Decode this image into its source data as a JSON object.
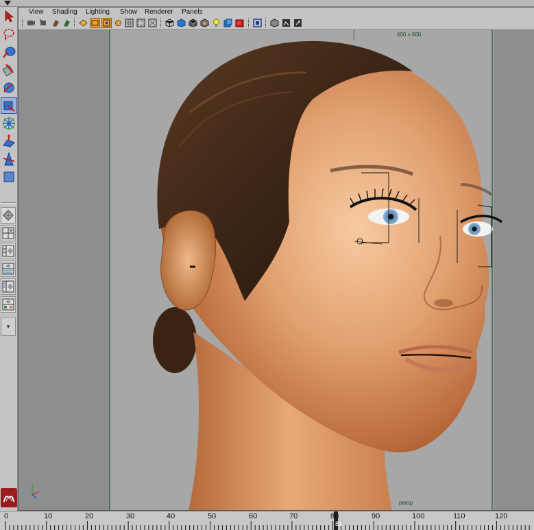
{
  "menubar": {
    "items": [
      "View",
      "Shading",
      "Lighting",
      "Show",
      "Renderer",
      "Panels"
    ]
  },
  "viewport": {
    "resolution_label": "600 x 600",
    "camera_label": "persp"
  },
  "timeline": {
    "ticks": [
      "0",
      "10",
      "20",
      "30",
      "40",
      "50",
      "60",
      "70",
      "80",
      "90",
      "100",
      "110",
      "120"
    ],
    "current_frame": "81"
  },
  "toolbox": {
    "layout_dropdown_symbol": "▾"
  },
  "colors": {
    "ui_gray": "#c4c4c4",
    "viewport_bg": "#8e8e8e",
    "resolution_gate": "#a7a7a7",
    "skin": "#d9976a",
    "hair": "#3a2415",
    "active_tool": "#9fb3d6",
    "active_toggle": "#f0a030",
    "gate_line": "#1f5a36"
  },
  "icons": {
    "tools": [
      "select-arrow-icon",
      "lasso-icon",
      "paint-select-icon",
      "move-icon",
      "rotate-icon",
      "scale-icon",
      "universal-manip-icon",
      "soft-mod-icon",
      "show-manipulator-icon"
    ],
    "layouts": [
      "single-perspective-icon",
      "four-view-icon",
      "two-panes-icon",
      "persp-outliner-icon",
      "persp-graph-icon",
      "persp-hypershade-icon",
      "persp-trax-icon"
    ],
    "panel_toolbar": [
      "select-camera-icon",
      "previous-view-icon",
      "next-view-icon",
      "bookmark-icon",
      "grid-icon",
      "film-gate-icon",
      "resolution-gate-icon",
      "gate-mask-icon",
      "field-chart-icon",
      "safe-action-icon",
      "safe-title-icon",
      "wireframe-icon",
      "smooth-shade-icon",
      "textured-icon",
      "use-lights-icon",
      "shadows-icon",
      "isolate-select-icon",
      "xray-icon",
      "backface-culling-icon"
    ]
  }
}
